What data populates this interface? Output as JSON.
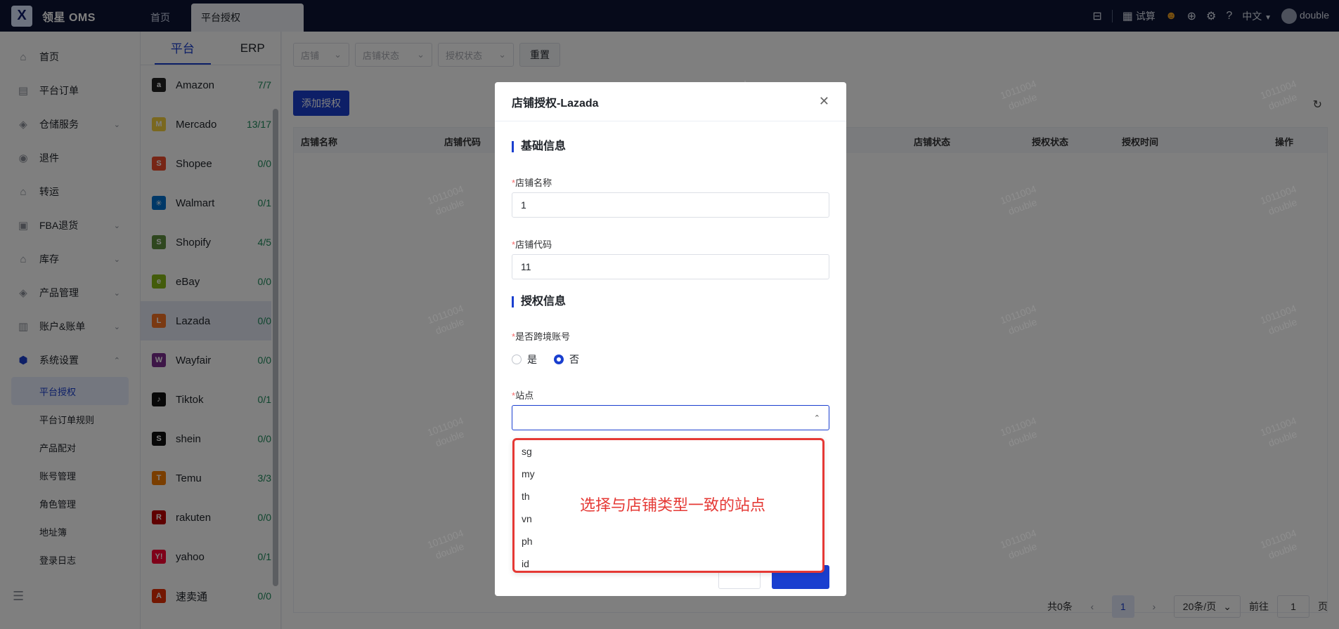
{
  "app": {
    "logo_glyph": "X",
    "title": "领星 OMS"
  },
  "tabs": [
    {
      "label": "首页"
    },
    {
      "label": "平台授权"
    }
  ],
  "topbar": {
    "calc_label": "试算",
    "lang": "中文",
    "user": "double"
  },
  "sidebar": {
    "items": [
      {
        "label": "首页",
        "icon": "home-icon"
      },
      {
        "label": "平台订单",
        "icon": "order-icon"
      },
      {
        "label": "仓储服务",
        "icon": "warehouse-icon"
      },
      {
        "label": "退件",
        "icon": "return-icon"
      },
      {
        "label": "转运",
        "icon": "transfer-icon"
      },
      {
        "label": "FBA退货",
        "icon": "fba-icon"
      },
      {
        "label": "库存",
        "icon": "stock-icon"
      },
      {
        "label": "产品管理",
        "icon": "product-icon"
      },
      {
        "label": "账户&账单",
        "icon": "account-icon"
      },
      {
        "label": "系统设置",
        "icon": "settings-icon"
      }
    ],
    "subitems": [
      {
        "label": "平台授权"
      },
      {
        "label": "平台订单规则"
      },
      {
        "label": "产品配对"
      },
      {
        "label": "账号管理"
      },
      {
        "label": "角色管理"
      },
      {
        "label": "地址簿"
      },
      {
        "label": "登录日志"
      }
    ]
  },
  "platform_tabs": [
    {
      "label": "平台"
    },
    {
      "label": "ERP"
    }
  ],
  "platforms": [
    {
      "name": "Amazon",
      "count": "7/7",
      "color": "#222222",
      "glyph": "a"
    },
    {
      "name": "Mercado",
      "count": "13/17",
      "color": "#f4d03f",
      "glyph": "M"
    },
    {
      "name": "Shopee",
      "count": "0/0",
      "color": "#ee4d2d",
      "glyph": "S"
    },
    {
      "name": "Walmart",
      "count": "0/1",
      "color": "#0071ce",
      "glyph": "✳"
    },
    {
      "name": "Shopify",
      "count": "4/5",
      "color": "#5e8e3e",
      "glyph": "S"
    },
    {
      "name": "eBay",
      "count": "0/0",
      "color": "#86b817",
      "glyph": "e"
    },
    {
      "name": "Lazada",
      "count": "0/0",
      "color": "#f57224",
      "glyph": "L"
    },
    {
      "name": "Wayfair",
      "count": "0/0",
      "color": "#7b2d8e",
      "glyph": "W"
    },
    {
      "name": "Tiktok",
      "count": "0/1",
      "color": "#111111",
      "glyph": "♪"
    },
    {
      "name": "shein",
      "count": "0/0",
      "color": "#111111",
      "glyph": "S"
    },
    {
      "name": "Temu",
      "count": "3/3",
      "color": "#f57c00",
      "glyph": "T"
    },
    {
      "name": "rakuten",
      "count": "0/0",
      "color": "#bf0000",
      "glyph": "R"
    },
    {
      "name": "yahoo",
      "count": "0/1",
      "color": "#ff0033",
      "glyph": "Y!"
    },
    {
      "name": "速卖通",
      "count": "0/0",
      "color": "#e62e04",
      "glyph": "A"
    }
  ],
  "filters": {
    "shop": "店铺",
    "shop_status": "店铺状态",
    "auth_status": "授权状态",
    "reset": "重置"
  },
  "add_button": "添加授权",
  "table_headers": [
    "店铺名称",
    "店铺代码",
    "店铺状态",
    "授权状态",
    "授权时间",
    "操作"
  ],
  "pager": {
    "total": "共0条",
    "page": "1",
    "size": "20条/页",
    "goto": "前往",
    "goto_value": "1",
    "unit": "页"
  },
  "watermark": {
    "line1": "1011004",
    "line2": "double"
  },
  "dialog": {
    "title": "店铺授权-Lazada",
    "section_basic": "基础信息",
    "shop_name_label": "店铺名称",
    "shop_name_value": "1",
    "shop_code_label": "店铺代码",
    "shop_code_value": "11",
    "section_auth": "授权信息",
    "cross_border_label": "是否跨境账号",
    "radio_yes": "是",
    "radio_no": "否",
    "site_label": "站点",
    "site_value": ""
  },
  "site_options": [
    "sg",
    "my",
    "th",
    "vn",
    "ph",
    "id"
  ],
  "annotation": "选择与店铺类型一致的站点",
  "colors": {
    "accent": "#1a3fcf",
    "topbar": "#0d1535",
    "highlight": "#e53935",
    "count": "#1c8a5b"
  }
}
